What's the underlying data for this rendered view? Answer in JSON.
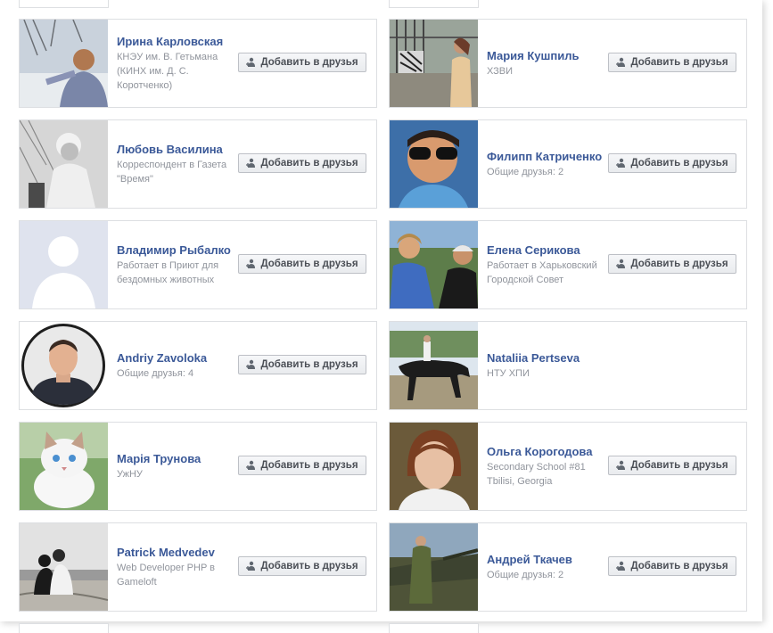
{
  "button_label": "Добавить в друзья",
  "people": [
    {
      "name": "Ирина Карловская",
      "subtitle": "КНЭУ им. В. Гетьмана (КИНХ им. Д. С. Коротченко)",
      "photo": "woman-winter-photo",
      "button": true
    },
    {
      "name": "Мария Кушпиль",
      "subtitle": "ХЗВИ",
      "photo": "woman-zebra-photo",
      "button": true
    },
    {
      "name": "Любовь Василина",
      "subtitle": "Корреспондент в Газета \"Время\"",
      "photo": "girl-bw-photo",
      "button": true
    },
    {
      "name": "Филипп Катриченко",
      "subtitle": "Общие друзья: 2",
      "photo": "man-sunglasses-photo",
      "button": true
    },
    {
      "name": "Владимир Рыбалко",
      "subtitle": "Работает в Приют для бездомных животных",
      "photo": "default-avatar-photo",
      "button": true
    },
    {
      "name": "Елена Серикова",
      "subtitle": "Работает в Харьковский Городской Совет",
      "photo": "women-outdoor-photo",
      "button": true
    },
    {
      "name": "Andriy Zavoloka",
      "subtitle": "Общие друзья: 4",
      "photo": "man-portrait-photo",
      "button": true
    },
    {
      "name": "Nataliia Pertseva",
      "subtitle": "НТУ ХПИ",
      "photo": "horse-rider-photo",
      "button": false
    },
    {
      "name": "Марія Трунова",
      "subtitle": "УжНУ",
      "photo": "kitten-photo",
      "button": true
    },
    {
      "name": "Ольга Корогодова",
      "subtitle": "Secondary School #81 Tbilisi, Georgia",
      "photo": "woman-portrait-photo",
      "button": true
    },
    {
      "name": "Patrick Medvedev",
      "subtitle": "Web Developer PHP в Gameloft",
      "photo": "couple-beach-photo",
      "button": true
    },
    {
      "name": "Андрей Ткачев",
      "subtitle": "Общие друзья: 2",
      "photo": "soldier-tank-photo",
      "button": true
    }
  ]
}
